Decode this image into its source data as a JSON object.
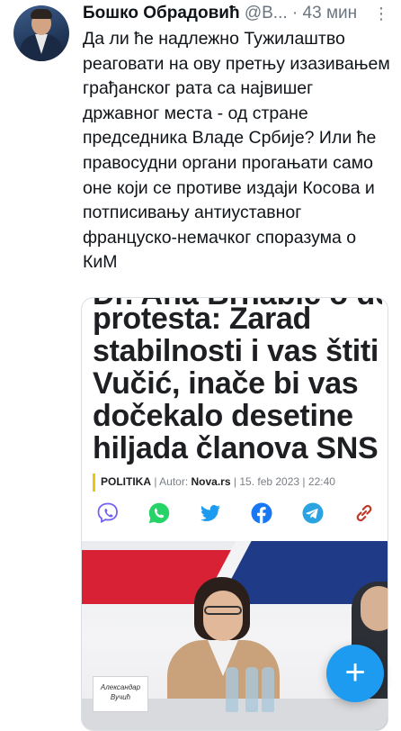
{
  "tweet": {
    "author_name": "Бошко Обрадовић",
    "author_handle": "@B...",
    "separator": "·",
    "time": "43 мин",
    "menu_icon": "more-vertical-icon",
    "text": "Да ли ће надлежно Тужилаштво реаговати на ову претњу изазивањем грађанског рата са највишег државног места - од стране председника Владе Србије? Или ће правосудни органи прогањати само оне који се противе издаји Косова и потписивању антиуставног француско-немачког споразума о КиМ"
  },
  "card": {
    "headline_cut": "Dr. Ana Brnabić o desničkim",
    "headline": "protesta: Zarad stabilnosti i vas štiti Vučić, inače bi vas dočekalo desetine hiljada članova SNS",
    "category": "POLITIKA",
    "author_label": "Autor:",
    "source": "Nova.rs",
    "date": "15. feb 2023",
    "time": "22:40",
    "accent_color": "#f1c40f",
    "share_icons": [
      "viber-icon",
      "whatsapp-icon",
      "twitter-icon",
      "facebook-icon",
      "telegram-icon",
      "link-icon"
    ],
    "photo_nameplate": "Александар Вучић"
  },
  "fab": {
    "label": "+",
    "color": "#1d9bf0"
  }
}
